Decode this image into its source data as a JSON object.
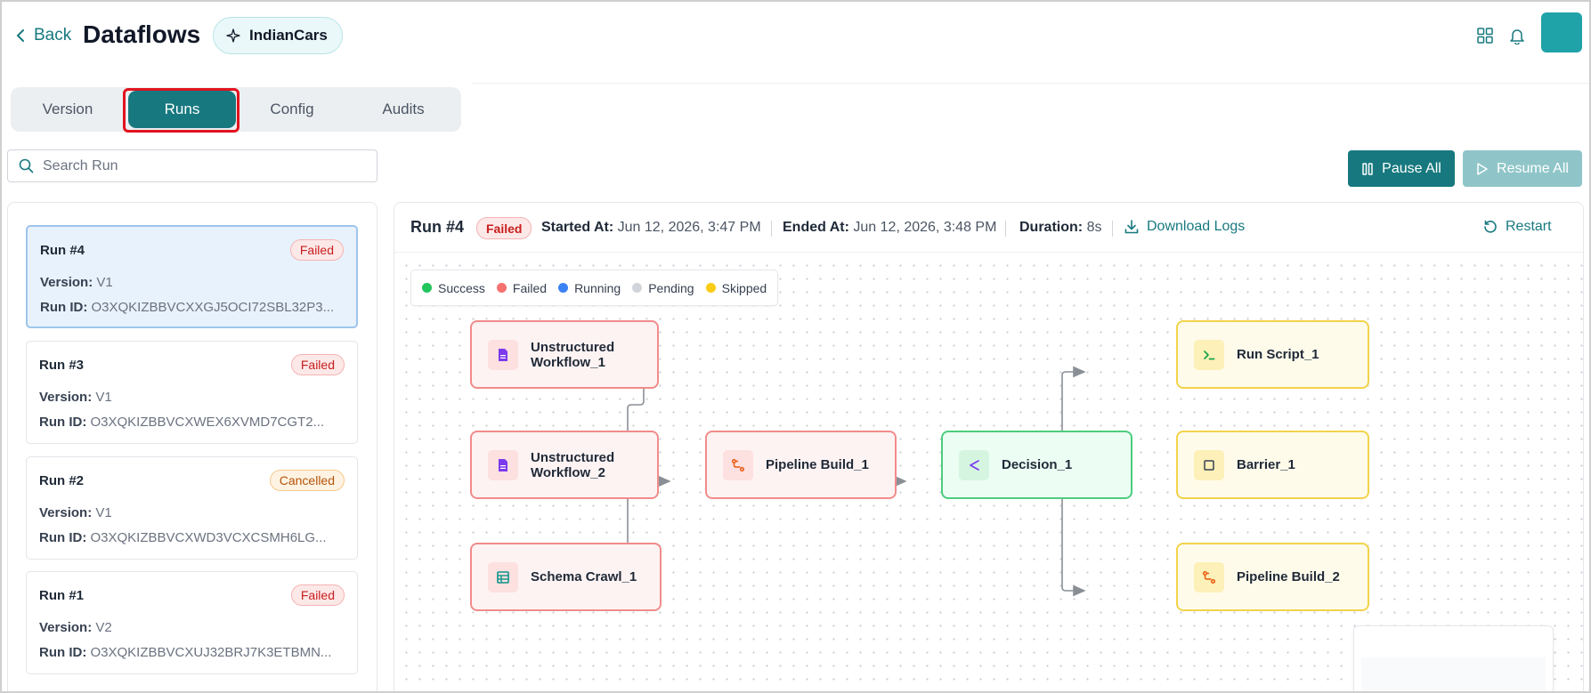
{
  "header": {
    "back_label": "Back",
    "title": "Dataflows",
    "org_name": "IndianCars",
    "brand_color": "#17797f"
  },
  "tabs": [
    {
      "label": "Version",
      "active": false
    },
    {
      "label": "Runs",
      "active": true
    },
    {
      "label": "Config",
      "active": false
    },
    {
      "label": "Audits",
      "active": false
    }
  ],
  "search": {
    "placeholder": "Search Run",
    "value": ""
  },
  "actions": {
    "pause_label": "Pause All",
    "resume_label": "Resume All"
  },
  "runs": [
    {
      "name": "Run #4",
      "status": "Failed",
      "version_label": "Version:",
      "version": "V1",
      "id_label": "Run ID:",
      "run_id": "O3XQKIZBBVCXXGJ5OCI72SBL32P3...",
      "selected": true
    },
    {
      "name": "Run #3",
      "status": "Failed",
      "version_label": "Version:",
      "version": "V1",
      "id_label": "Run ID:",
      "run_id": "O3XQKIZBBVCXWEX6XVMD7CGT2...",
      "selected": false
    },
    {
      "name": "Run #2",
      "status": "Cancelled",
      "version_label": "Version:",
      "version": "V1",
      "id_label": "Run ID:",
      "run_id": "O3XQKIZBBVCXWD3VCXCSMH6LG...",
      "selected": false
    },
    {
      "name": "Run #1",
      "status": "Failed",
      "version_label": "Version:",
      "version": "V2",
      "id_label": "Run ID:",
      "run_id": "O3XQKIZBBVCXUJ32BRJ7K3ETBMN...",
      "selected": false
    }
  ],
  "detail": {
    "run_name": "Run #4",
    "status": "Failed",
    "started_label": "Started At:",
    "started_at": "Jun 12, 2026, 3:47 PM",
    "ended_label": "Ended At:",
    "ended_at": "Jun 12, 2026, 3:48 PM",
    "duration_label": "Duration:",
    "duration": "8s",
    "download_label": "Download Logs",
    "restart_label": "Restart"
  },
  "legend": [
    {
      "label": "Success",
      "color": "#22c55e"
    },
    {
      "label": "Failed",
      "color": "#f87171"
    },
    {
      "label": "Running",
      "color": "#3b82f6"
    },
    {
      "label": "Pending",
      "color": "#d1d5db"
    },
    {
      "label": "Skipped",
      "color": "#facc15"
    }
  ],
  "nodes": [
    {
      "label": "Unstructured Workflow_1",
      "status": "failed",
      "icon": "document-icon"
    },
    {
      "label": "Unstructured Workflow_2",
      "status": "failed",
      "icon": "document-icon"
    },
    {
      "label": "Schema Crawl_1",
      "status": "failed",
      "icon": "table-icon"
    },
    {
      "label": "Pipeline Build_1",
      "status": "failed",
      "icon": "branch-icon"
    },
    {
      "label": "Decision_1",
      "status": "success",
      "icon": "split-icon"
    },
    {
      "label": "Run Script_1",
      "status": "skipped",
      "icon": "terminal-icon"
    },
    {
      "label": "Barrier_1",
      "status": "skipped",
      "icon": "square-icon"
    },
    {
      "label": "Pipeline Build_2",
      "status": "skipped",
      "icon": "branch-icon"
    }
  ]
}
